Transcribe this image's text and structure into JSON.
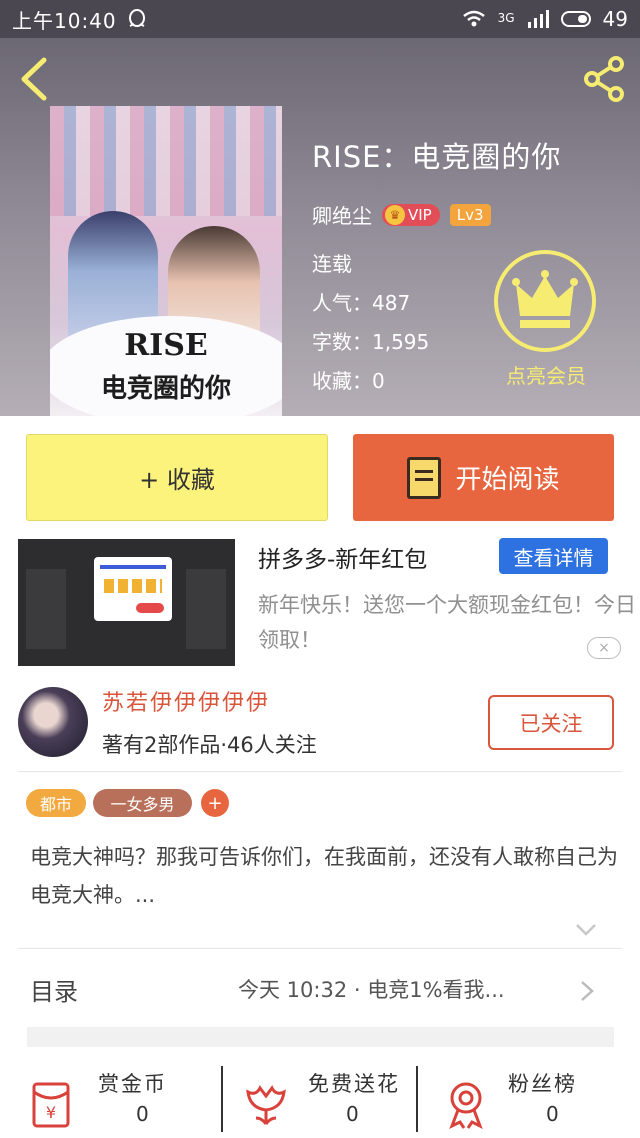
{
  "status_bar": {
    "time": "上午10:40",
    "network": "3G",
    "battery": "49"
  },
  "header": {
    "cover_title_line1": "RISE",
    "cover_title_line2": "电竞圈的你",
    "book_title": "RISE：电竞圈的你",
    "author": "卿绝尘",
    "vip_label": "VIP",
    "level": "Lv3",
    "status": "连载",
    "popularity": "人气：487",
    "word_count": "字数：1,595",
    "favorites": "收藏：0",
    "member_label": "点亮会员"
  },
  "actions": {
    "collect_label": "+ 收藏",
    "read_label": "开始阅读"
  },
  "ad": {
    "title": "拼多多-新年红包",
    "detail_button": "查看详情",
    "description": "新年快乐！送您一个大额现金红包！今日领取！",
    "close_label": "×"
  },
  "author_section": {
    "name": "苏若伊伊伊伊伊",
    "stats": "著有2部作品·46人关注",
    "follow_label": "已关注"
  },
  "tags": [
    "都市",
    "一女多男",
    "+"
  ],
  "synopsis": "电竞大神吗？那我可告诉你们，在我面前，还没有人敢称自己为电竞大神。...",
  "catalog": {
    "label": "目录",
    "latest": "今天 10:32 · 电竞1%看我..."
  },
  "bottom_bar": {
    "reward": {
      "label": "赏金币",
      "count": "0"
    },
    "flower": {
      "label": "免费送花",
      "count": "0"
    },
    "fans": {
      "label": "粉丝榜",
      "count": "0"
    }
  },
  "colors": {
    "accent_orange": "#e8663f",
    "collect_yellow": "#fbf37c",
    "member_yellow": "#f7ec72",
    "ad_blue": "#2d72e0",
    "author_red": "#d9553b"
  },
  "icons": [
    "back-icon",
    "share-icon",
    "crown-icon",
    "book-icon",
    "chevron-down-icon",
    "chevron-right-icon",
    "red-envelope-icon",
    "flower-icon",
    "medal-icon"
  ]
}
